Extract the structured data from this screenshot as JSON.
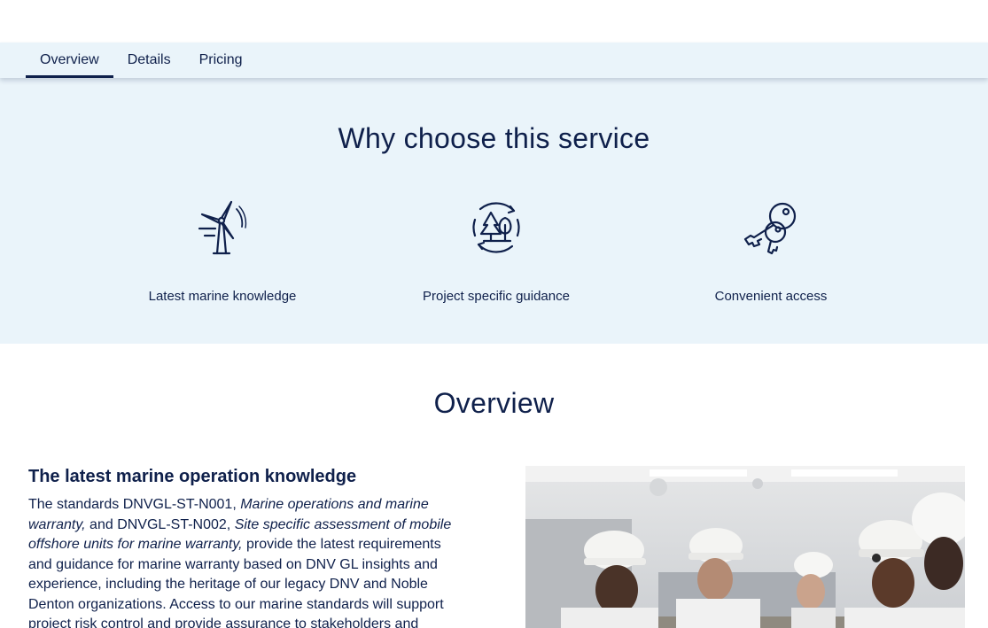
{
  "tabs": [
    {
      "label": "Overview",
      "active": true
    },
    {
      "label": "Details",
      "active": false
    },
    {
      "label": "Pricing",
      "active": false
    }
  ],
  "why": {
    "title": "Why choose this service",
    "features": [
      {
        "icon": "wind-turbine-icon",
        "label": "Latest marine knowledge"
      },
      {
        "icon": "forest-cycle-icon",
        "label": "Project specific guidance"
      },
      {
        "icon": "keys-icon",
        "label": "Convenient access"
      }
    ]
  },
  "overview": {
    "title": "Overview",
    "heading": "The latest marine operation knowledge",
    "p_intro": "The standards DNVGL-ST-N001, ",
    "p_em1": "Marine operations and marine warranty,",
    "p_mid": " and DNVGL-ST-N002, ",
    "p_em2": "Site specific assessment of mobile offshore units for marine warranty,",
    "p_rest": " provide the latest requirements and guidance for marine warranty based on DNV GL insights and experience, including the heritage of our legacy DNV and Noble Denton organizations. Access to our marine standards will support project risk control and provide assurance to stakeholders and"
  },
  "colors": {
    "navy": "#0f204b",
    "light_blue": "#eaf4fa"
  }
}
